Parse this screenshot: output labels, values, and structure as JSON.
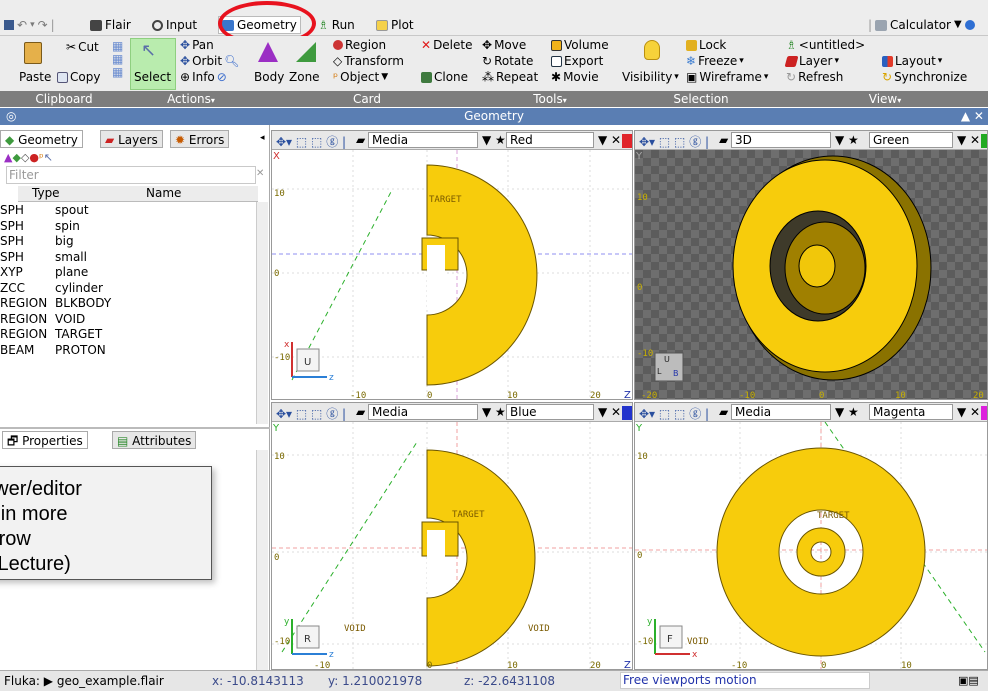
{
  "menu": {
    "flair": "Flair",
    "input": "Input",
    "geometry": "Geometry",
    "run": "Run",
    "plot": "Plot",
    "calculator": "Calculator"
  },
  "ribbon": {
    "cut": "Cut",
    "copy": "Copy",
    "paste": "Paste",
    "pan": "Pan",
    "orbit": "Orbit",
    "info": "Info",
    "select": "Select",
    "body": "Body",
    "zone": "Zone",
    "region": "Region",
    "transform": "Transform",
    "object": "Object",
    "delete": "Delete",
    "clone": "Clone",
    "move": "Move",
    "rotate": "Rotate",
    "repeat": "Repeat",
    "volume": "Volume",
    "export": "Export",
    "movie": "Movie",
    "visibility": "Visibility",
    "lock": "Lock",
    "freeze": "Freeze",
    "wireframe": "Wireframe",
    "untitled": "<untitled>",
    "layer": "Layer",
    "refresh": "Refresh",
    "layout": "Layout",
    "synchronize": "Synchronize"
  },
  "groups": {
    "clipboard": "Clipboard",
    "actions": "Actions",
    "card": "Card",
    "tools": "Tools",
    "selection": "Selection",
    "view": "View"
  },
  "window_title": "Geometry",
  "left_panel": {
    "tabs": [
      "Geometry",
      "Layers",
      "Errors"
    ],
    "filter_placeholder": "Filter",
    "columns": [
      "Type",
      "Name"
    ],
    "rows": [
      {
        "type": "SPH",
        "name": "spout"
      },
      {
        "type": "SPH",
        "name": "spin"
      },
      {
        "type": "SPH",
        "name": "big"
      },
      {
        "type": "SPH",
        "name": "small"
      },
      {
        "type": "XYP",
        "name": "plane"
      },
      {
        "type": "ZCC",
        "name": "cylinder"
      },
      {
        "type": "REGION",
        "name": "BLKBODY"
      },
      {
        "type": "REGION",
        "name": "VOID"
      },
      {
        "type": "REGION",
        "name": "TARGET"
      },
      {
        "type": "BEAM",
        "name": "PROTON"
      }
    ],
    "prop_tabs": [
      "Properties",
      "Attributes"
    ]
  },
  "viewports": {
    "red": {
      "mode": "Media",
      "color": "Red",
      "accent": "#e0242a",
      "axis_v": "X",
      "axis_h": "Z",
      "orient": "U",
      "ticks_x": [
        "-10",
        "0",
        "10",
        "20"
      ],
      "ticks_y": [
        "10",
        "0",
        "-10"
      ],
      "label": "TARGET"
    },
    "green": {
      "mode": "3D",
      "color": "Green",
      "accent": "#22aa22",
      "axis_v": "Y",
      "ticks_x": [
        "-20",
        "-10",
        "0",
        "10",
        "20"
      ],
      "ticks_y": [
        "10",
        "0",
        "-10"
      ],
      "cube": [
        "U",
        "L",
        "B"
      ]
    },
    "blue": {
      "mode": "Media",
      "color": "Blue",
      "accent": "#2233cc",
      "axis_v": "Y",
      "axis_h": "Z",
      "orient": "R",
      "ticks_x": [
        "-10",
        "0",
        "10",
        "20"
      ],
      "ticks_y": [
        "10",
        "0",
        "-10"
      ],
      "label": "TARGET",
      "void1": "VOID",
      "void2": "VOID"
    },
    "magenta": {
      "mode": "Media",
      "color": "Magenta",
      "accent": "#dd22dd",
      "axis_v": "Y",
      "axis_h": "X",
      "orient": "F",
      "ticks_x": [
        "-10",
        "0",
        "10"
      ],
      "ticks_y": [
        "10",
        "0",
        "-10"
      ],
      "label": "TARGET",
      "void1": "VOID"
    }
  },
  "status": {
    "file": "Fluka: ▶ geo_example.flair",
    "x": "x: -10.8143113",
    "y": "y: 1.210021978",
    "z": "z: -22.6431108",
    "message": "Free viewports motion"
  },
  "callout_lines": [
    "y viewer/editor",
    "ssed in more",
    "omorrow",
    "ditor Lecture)"
  ],
  "colors": {
    "material": "#f7cc0c",
    "select_bg": "#b9ecae",
    "titlebar": "#5a7eb3",
    "groupbar": "#7d7d7d",
    "highlight_ring": "#e8121e"
  }
}
